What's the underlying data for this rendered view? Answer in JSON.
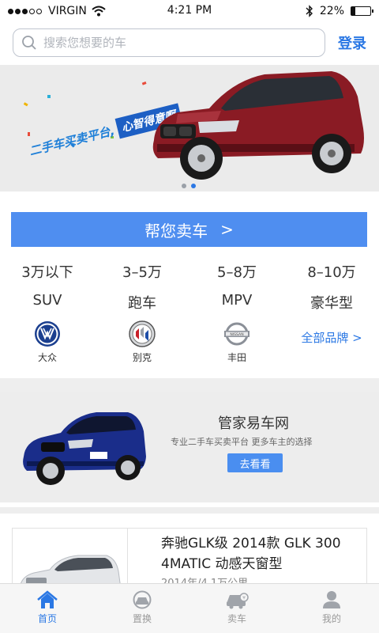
{
  "status_bar": {
    "carrier": "VIRGIN",
    "time": "4:21 PM",
    "battery": "22%",
    "battery_level": 0.22
  },
  "header": {
    "search_placeholder": "搜索您想要的车",
    "login_label": "登录"
  },
  "banner": {
    "slogan_a": "二手车买卖平台,",
    "slogan_b": "心智得意啊",
    "slides": 2,
    "active_slide": 2
  },
  "sell": {
    "label": "帮您卖车",
    "arrow": ">"
  },
  "price_filters": [
    "3万以下",
    "3–5万",
    "5–8万",
    "8–10万"
  ],
  "type_filters": [
    "SUV",
    "跑车",
    "MPV",
    "豪华型"
  ],
  "brands": [
    {
      "name": "大众",
      "icon": "volkswagen-logo-icon"
    },
    {
      "name": "别克",
      "icon": "buick-logo-icon"
    },
    {
      "name": "丰田",
      "icon": "nissan-logo-icon"
    }
  ],
  "all_brands": "全部品牌 >",
  "ad": {
    "title": "管家易车网",
    "subtitle": "专业二手车买卖平台  更多车主的选择",
    "button": "去看看"
  },
  "listing": {
    "title": "奔驰GLK级 2014款 GLK 300 4MATIC 动感天窗型",
    "meta": "2014年/4.1万公里"
  },
  "tabs": [
    {
      "label": "首页",
      "icon": "home-icon",
      "active": true
    },
    {
      "label": "置换",
      "icon": "exchange-car-icon",
      "active": false
    },
    {
      "label": "卖车",
      "icon": "sell-car-icon",
      "active": false
    },
    {
      "label": "我的",
      "icon": "user-icon",
      "active": false
    }
  ],
  "colors": {
    "accent": "#2b78e4",
    "sell_bar": "#4f8ef0",
    "banner_car": "#8a1b24",
    "ad_car": "#1a2d8a"
  }
}
